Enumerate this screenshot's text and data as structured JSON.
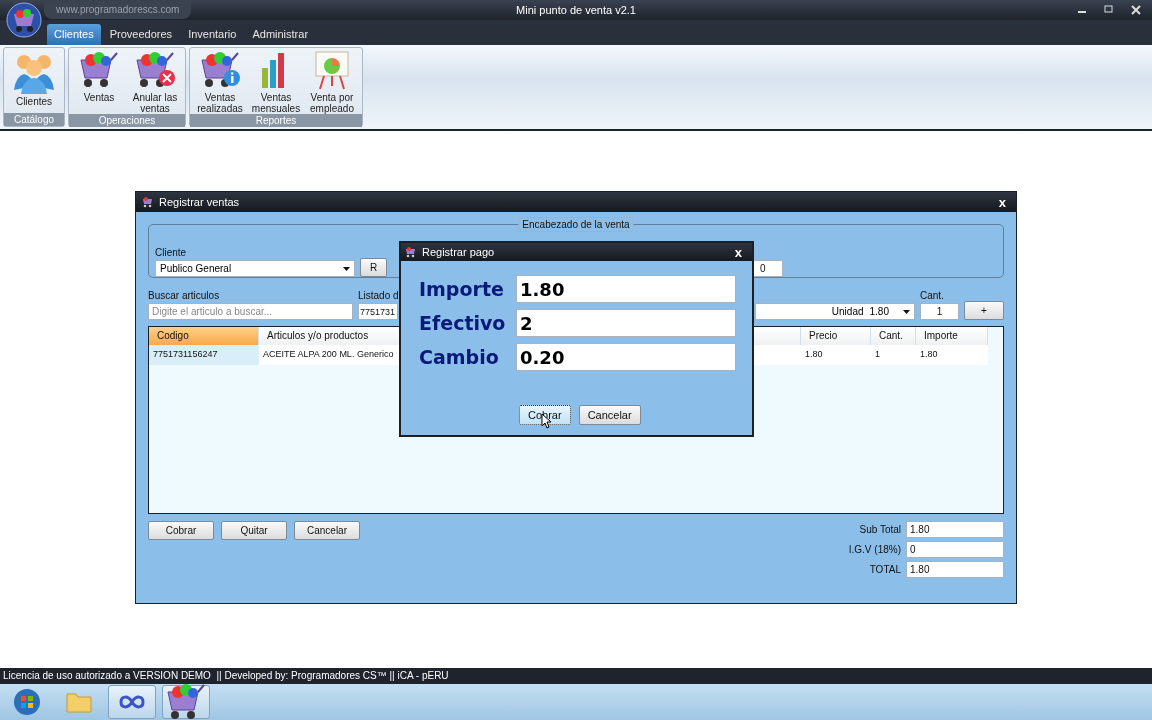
{
  "app": {
    "url_tab": "www.programadorescs.com",
    "title": "Mini punto de venta v2.1"
  },
  "menu_tabs": [
    {
      "label": "Clientes",
      "selected": true
    },
    {
      "label": "Proveedores",
      "selected": false
    },
    {
      "label": "Inventario",
      "selected": false
    },
    {
      "label": "Administrar",
      "selected": false
    }
  ],
  "ribbon": [
    {
      "label": "Catálogo",
      "buttons": [
        {
          "label": "Clientes",
          "kind": "people"
        }
      ]
    },
    {
      "label": "Operaciones",
      "buttons": [
        {
          "label": "Ventas",
          "kind": "cart"
        },
        {
          "label": "Anular las ventas",
          "kind": "cart-cancel"
        }
      ]
    },
    {
      "label": "Reportes",
      "buttons": [
        {
          "label": "Ventas realizadas",
          "kind": "cart-info"
        },
        {
          "label": "Ventas mensuales",
          "kind": "bars"
        },
        {
          "label": "Venta por empleado",
          "kind": "easel"
        }
      ]
    }
  ],
  "sales_window": {
    "title": "Registrar ventas",
    "close": "x",
    "header": {
      "legend": "Encabezado de la venta",
      "client_label": "Cliente",
      "client_value": "Publico General",
      "r_button": "R",
      "field_value": "0"
    },
    "search": {
      "label": "Buscar articulos",
      "placeholder": "Digite el articulo a buscar..."
    },
    "listado": {
      "label": "Listado d",
      "value": "7751731"
    },
    "unit": {
      "label": "Unidad",
      "value": "1.80"
    },
    "qty": {
      "label": "Cant.",
      "value": "1"
    },
    "add_button": "+",
    "table": {
      "columns": [
        {
          "label": "Codigo",
          "selected": true
        },
        {
          "label": "Articulos y/o productos",
          "selected": false
        },
        {
          "label": "Precio",
          "selected": false
        },
        {
          "label": "Cant.",
          "selected": false
        },
        {
          "label": "Importe",
          "selected": false
        }
      ],
      "rows": [
        [
          "7751731156247",
          "ACEITE ALPA 200 ML. Generico",
          "1.80",
          "1",
          "1.80"
        ]
      ]
    },
    "buttons": [
      "Cobrar",
      "Quitar",
      "Cancelar"
    ],
    "totals": [
      {
        "label": "Sub Total",
        "value": "1.80"
      },
      {
        "label": "I.G.V (18%)",
        "value": "0"
      },
      {
        "label": "TOTAL",
        "value": "1.80"
      }
    ]
  },
  "payment_dialog": {
    "title": "Registrar pago",
    "close": "x",
    "fields": [
      {
        "label": "Importe",
        "value": "1.80"
      },
      {
        "label": "Efectivo",
        "value": "2"
      },
      {
        "label": "Cambio",
        "value": "0.20"
      }
    ],
    "buttons": [
      {
        "label": "Cobrar",
        "focused": true
      },
      {
        "label": "Cancelar",
        "focused": false
      }
    ]
  },
  "status_bar": "Licencia de uso autorizado a VERSION DEMO  || Developed by: Programadores CS™ || iCA - pERU"
}
